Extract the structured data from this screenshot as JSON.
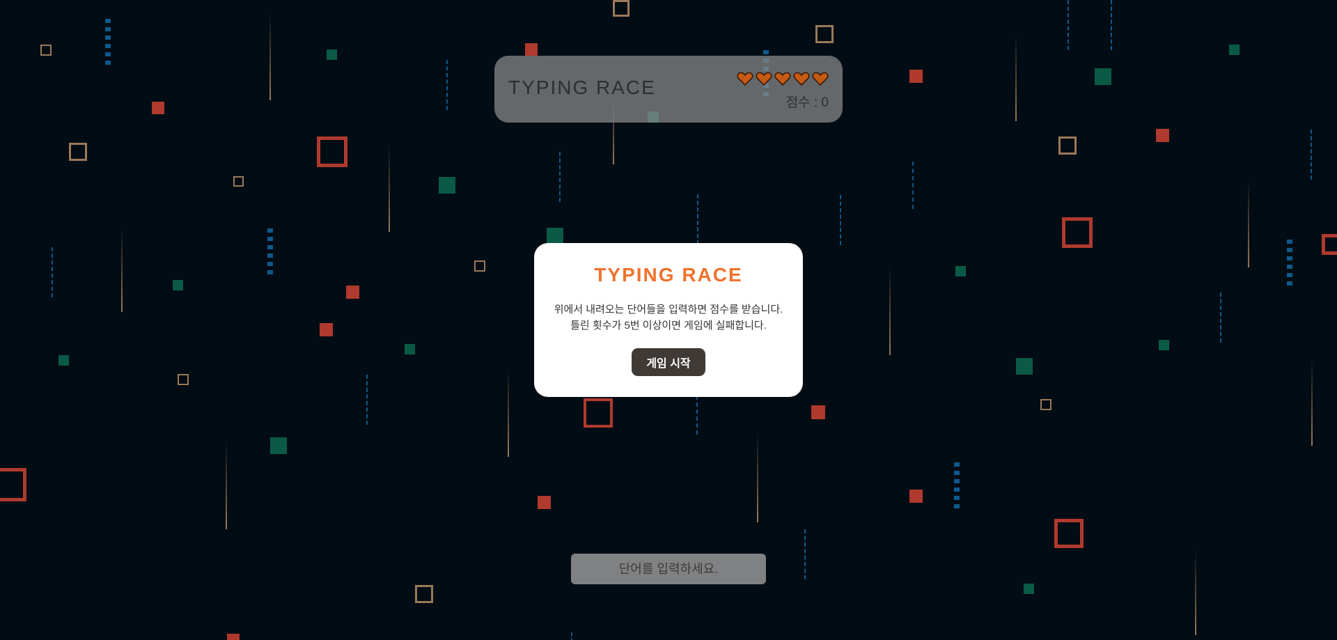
{
  "header": {
    "title": "TYPING RACE",
    "lives": 5,
    "score_label": "점수 : 0"
  },
  "modal": {
    "title": "TYPING RACE",
    "description_line1": "위에서 내려오는 단어들을 입력하면 점수를 받습니다.",
    "description_line2": "틀린 횟수가 5번 이상이면 게임에 실패합니다.",
    "start_label": "게임 시작"
  },
  "input": {
    "placeholder": "단어를 입력하세요."
  },
  "colors": {
    "background": "#020c14",
    "accent": "#f0722d",
    "heart": "#c65a14",
    "red": "#b03a2e",
    "green": "#0b5a45",
    "tan": "#9a7a5a",
    "blue": "#0f5a8a"
  },
  "icons": {
    "heart": "heart-icon"
  }
}
